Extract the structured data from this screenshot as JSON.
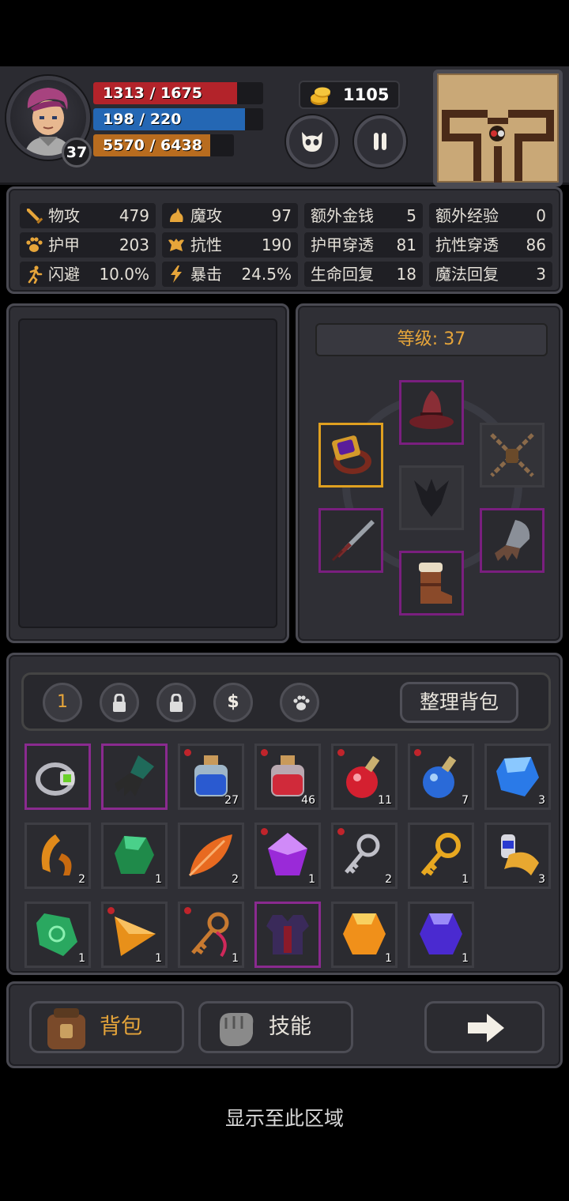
{
  "player": {
    "level": "37",
    "hp": "1313 / 1675",
    "mp": "198 / 220",
    "xp": "5570 / 6438",
    "hp_fraction": 0.784,
    "mp_fraction": 0.9,
    "xp_fraction": 0.865,
    "gold": "1105"
  },
  "hud_buttons": {
    "face_icon": "mask-icon",
    "pause_icon": "pause-icon"
  },
  "stats": [
    {
      "label": "物攻",
      "value": "479",
      "icon": "sword-icon"
    },
    {
      "label": "魔攻",
      "value": "97",
      "icon": "magic-hand-icon"
    },
    {
      "label": "额外金钱",
      "value": "5"
    },
    {
      "label": "额外经验",
      "value": "0"
    },
    {
      "label": "护甲",
      "value": "203",
      "icon": "paw-icon"
    },
    {
      "label": "抗性",
      "value": "190",
      "icon": "resist-icon"
    },
    {
      "label": "护甲穿透",
      "value": "81"
    },
    {
      "label": "抗性穿透",
      "value": "86"
    },
    {
      "label": "闪避",
      "value": "10.0%",
      "icon": "running-icon"
    },
    {
      "label": "暴击",
      "value": "24.5%",
      "icon": "lightning-icon"
    },
    {
      "label": "生命回复",
      "value": "18"
    },
    {
      "label": "魔法回复",
      "value": "3"
    }
  ],
  "equipment": {
    "level_label": "等级: 37",
    "slots": [
      "hat-icon",
      "ring-icon",
      "chain-icon",
      "chest-silhouette-icon",
      "sword-icon",
      "gauntlet-icon",
      "boots-icon"
    ]
  },
  "inventory": {
    "tabs": [
      "1",
      "lock-icon",
      "lock-icon",
      "$",
      "paw-icon"
    ],
    "sort_label": "整理背包",
    "items": [
      {
        "icon": "bracelet-icon",
        "count": ""
      },
      {
        "icon": "glove-icon",
        "count": ""
      },
      {
        "icon": "blue-jar-icon",
        "count": "27",
        "new": true
      },
      {
        "icon": "red-jar-icon",
        "count": "46",
        "new": true
      },
      {
        "icon": "red-potion-icon",
        "count": "11",
        "new": true
      },
      {
        "icon": "blue-potion-icon",
        "count": "7",
        "new": true
      },
      {
        "icon": "blue-gem-icon",
        "count": "3"
      },
      {
        "icon": "amber-claw-icon",
        "count": "2"
      },
      {
        "icon": "green-stone-icon",
        "count": "1"
      },
      {
        "icon": "orange-leaf-icon",
        "count": "2"
      },
      {
        "icon": "purple-gem-icon",
        "count": "1",
        "new": true
      },
      {
        "icon": "silver-key-icon",
        "count": "2",
        "new": true
      },
      {
        "icon": "gold-key-icon",
        "count": "1"
      },
      {
        "icon": "scroll-icon",
        "count": "3"
      },
      {
        "icon": "green-crystal-icon",
        "count": "1"
      },
      {
        "icon": "orange-shard-icon",
        "count": "1",
        "new": true
      },
      {
        "icon": "copper-key-icon",
        "count": "1",
        "new": true
      },
      {
        "icon": "armor-icon",
        "count": ""
      },
      {
        "icon": "orange-gem-icon",
        "count": "1"
      },
      {
        "icon": "indigo-gem-icon",
        "count": "1"
      }
    ]
  },
  "bottom_nav": {
    "bag_label": "背包",
    "skill_label": "技能",
    "next_icon": "arrow-right-icon"
  },
  "footer": "显示至此区域",
  "colors": {
    "accent": "#e6a53a",
    "hp": "#b3232a",
    "mp": "#2467b4",
    "xp": "#b86c1f",
    "epic": "#8a2a8f"
  }
}
